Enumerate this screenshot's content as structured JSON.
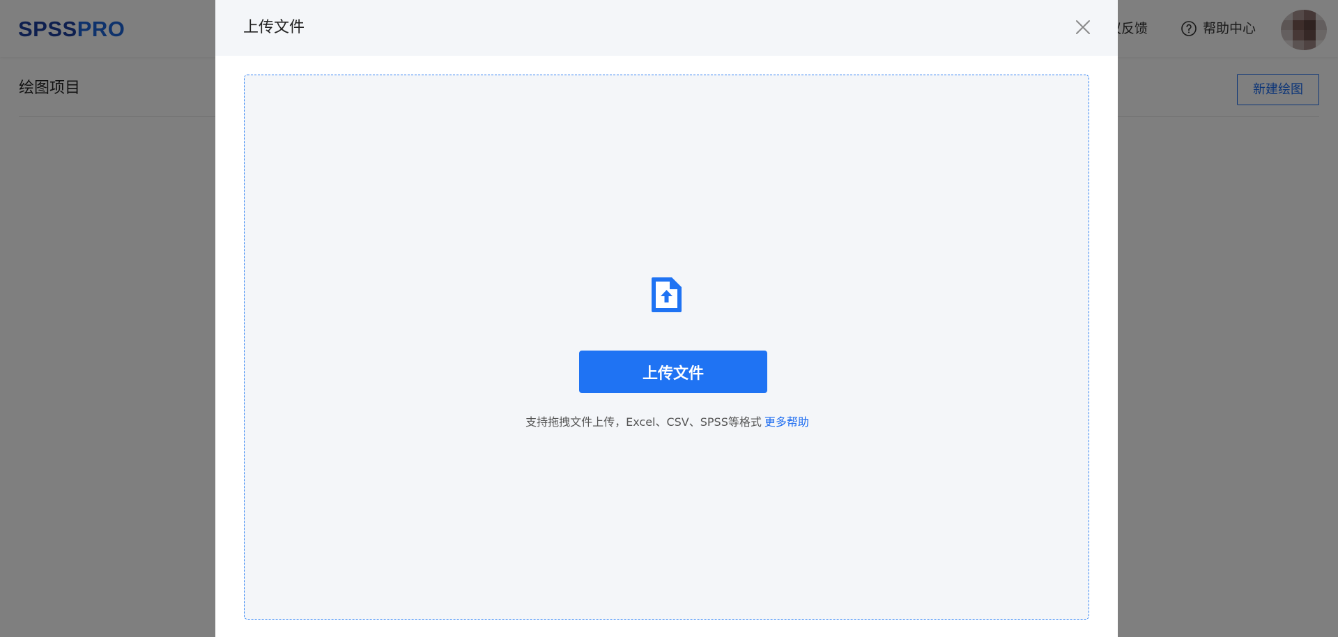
{
  "app": {
    "logo_part1": "SPSS",
    "logo_part2": "PRO"
  },
  "topnav": {
    "feedback_label": "议反馈",
    "help_label": "帮助中心",
    "help_icon": "question-circle-icon"
  },
  "page": {
    "title": "绘图项目",
    "new_chart_label": "新建绘图"
  },
  "modal": {
    "title": "上传文件",
    "close_icon": "close-icon",
    "upload_icon": "file-upload-icon",
    "upload_button_label": "上传文件",
    "hint_text": "支持拖拽文件上传，Excel、CSV、SPSS等格式",
    "more_help_label": "更多帮助"
  },
  "colors": {
    "accent": "#1f73f3",
    "logo_dark": "#1d3f9e",
    "logo_light": "#1d64d8",
    "overlay": "rgba(0,0,0,0.5)",
    "drop_zone_bg": "#f4f6f9"
  }
}
